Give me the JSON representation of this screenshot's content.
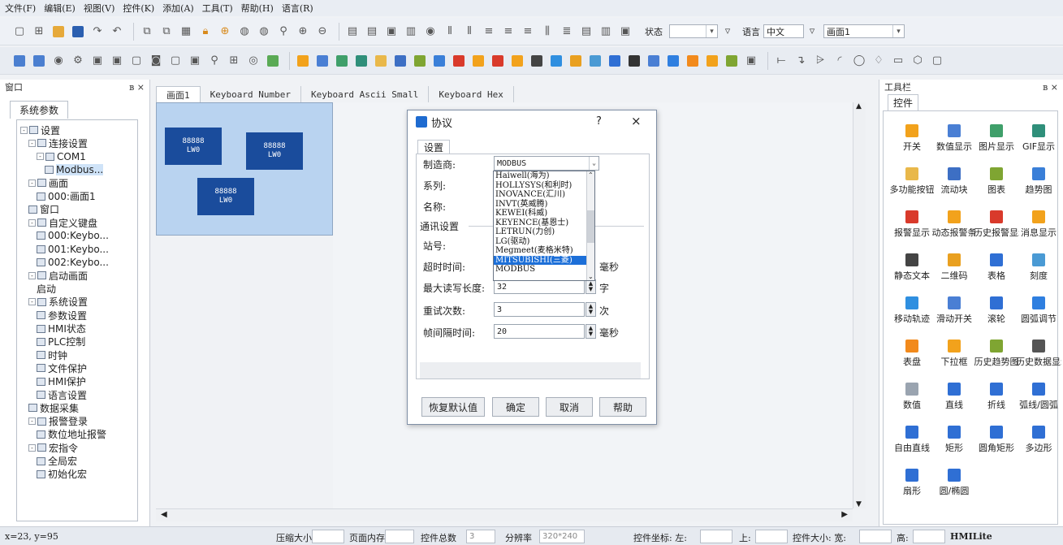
{
  "menu": [
    "文件(F)",
    "编辑(E)",
    "视图(V)",
    "控件(K)",
    "添加(A)",
    "工具(T)",
    "帮助(H)",
    "语言(R)"
  ],
  "toolbar": {
    "state_label": "状态",
    "state_value": "",
    "lang_label": "语言",
    "lang_value": "中文",
    "screen_value": "画面1"
  },
  "left_panel": {
    "title": "窗口",
    "pin": "ʙ ×",
    "tab": "系统参数",
    "tree": [
      {
        "label": "设置",
        "level": 0,
        "toggle": "-"
      },
      {
        "label": "连接设置",
        "level": 1,
        "toggle": "-"
      },
      {
        "label": "COM1",
        "level": 2,
        "toggle": "-"
      },
      {
        "label": "Modbus...",
        "level": 3,
        "toggle": "",
        "selected": true
      },
      {
        "label": "画面",
        "level": 1,
        "toggle": "-"
      },
      {
        "label": "000:画面1",
        "level": 2,
        "toggle": ""
      },
      {
        "label": "窗口",
        "level": 1,
        "toggle": ""
      },
      {
        "label": "自定义键盘",
        "level": 1,
        "toggle": "-"
      },
      {
        "label": "000:Keybo...",
        "level": 2,
        "toggle": ""
      },
      {
        "label": "001:Keybo...",
        "level": 2,
        "toggle": ""
      },
      {
        "label": "002:Keybo...",
        "level": 2,
        "toggle": ""
      },
      {
        "label": "启动画面",
        "level": 1,
        "toggle": "-"
      },
      {
        "label": "启动",
        "level": 2,
        "toggle": "",
        "noicon": true
      },
      {
        "label": "系统设置",
        "level": 1,
        "toggle": "-"
      },
      {
        "label": "参数设置",
        "level": 2,
        "toggle": ""
      },
      {
        "label": "HMI状态",
        "level": 2,
        "toggle": ""
      },
      {
        "label": "PLC控制",
        "level": 2,
        "toggle": ""
      },
      {
        "label": "时钟",
        "level": 2,
        "toggle": ""
      },
      {
        "label": "文件保护",
        "level": 2,
        "toggle": ""
      },
      {
        "label": "HMI保护",
        "level": 2,
        "toggle": ""
      },
      {
        "label": "语言设置",
        "level": 2,
        "toggle": ""
      },
      {
        "label": "数据采集",
        "level": 1,
        "toggle": ""
      },
      {
        "label": "报警登录",
        "level": 1,
        "toggle": "-"
      },
      {
        "label": "数位地址报警",
        "level": 2,
        "toggle": ""
      },
      {
        "label": "宏指令",
        "level": 1,
        "toggle": "-"
      },
      {
        "label": "全局宏",
        "level": 2,
        "toggle": ""
      },
      {
        "label": "初始化宏",
        "level": 2,
        "toggle": ""
      }
    ]
  },
  "tabs": [
    "画面1",
    "Keyboard Number",
    "Keyboard Ascii Small",
    "Keyboard Hex"
  ],
  "canvas": {
    "numeric": [
      {
        "value": "88888",
        "sub": "LW0"
      },
      {
        "value": "88888",
        "sub": "LW0"
      },
      {
        "value": "88888",
        "sub": "LW0"
      }
    ]
  },
  "dialog": {
    "title": "协议",
    "help": "?",
    "close": "×",
    "tab": "设置",
    "maker_label": "制造商:",
    "maker_value": "MODBUS",
    "series_label": "系列:",
    "name_label": "名称:",
    "comm_label": "通讯设置",
    "station_label": "站号:",
    "timeout_label": "超时时间:",
    "timeout_unit": "毫秒",
    "maxlen_label": "最大读写长度:",
    "maxlen_value": "32",
    "maxlen_unit": "字",
    "retry_label": "重试次数:",
    "retry_value": "3",
    "retry_unit": "次",
    "interval_label": "帧间隔时间:",
    "interval_value": "20",
    "interval_unit": "毫秒",
    "options": [
      "Haiwell(海为)",
      "HOLLYSYS(和利时)",
      "INOVANCE(汇川)",
      "INVT(英威腾)",
      "KEWEI(科威)",
      "KEYENCE(基恩士)",
      "LETRUN(力创)",
      "LG(驱动)",
      "Megmeet(麦格米特)",
      "MITSUBISHI(三菱)",
      "MODBUS"
    ],
    "highlighted": "MITSUBISHI(三菱)",
    "buttons": {
      "restore": "恢复默认值",
      "ok": "确定",
      "cancel": "取消",
      "help": "帮助"
    }
  },
  "right_panel": {
    "title": "工具栏",
    "pin": "ʙ ×",
    "tab": "控件",
    "widgets": [
      {
        "label": "开关",
        "color": "#f2a21c"
      },
      {
        "label": "数值显示",
        "color": "#4a7fd4"
      },
      {
        "label": "图片显示",
        "color": "#3f9f6a"
      },
      {
        "label": "GIF显示",
        "color": "#2f8f7a"
      },
      {
        "label": "多功能按钮",
        "color": "#e9b84a"
      },
      {
        "label": "流动块",
        "color": "#3d6fc4"
      },
      {
        "label": "图表",
        "color": "#7fa532"
      },
      {
        "label": "趋势图",
        "color": "#3a7fd8"
      },
      {
        "label": "报警显示",
        "color": "#d93a2b"
      },
      {
        "label": "动态报警条",
        "color": "#f2a21c"
      },
      {
        "label": "历史报警显示",
        "color": "#d93a2b"
      },
      {
        "label": "消息显示",
        "color": "#f2a21c"
      },
      {
        "label": "静态文本",
        "color": "#444444"
      },
      {
        "label": "二维码",
        "color": "#e9a020"
      },
      {
        "label": "表格",
        "color": "#2f6fd4"
      },
      {
        "label": "刻度",
        "color": "#4a9ad4"
      },
      {
        "label": "移动轨迹",
        "color": "#2f8fe0"
      },
      {
        "label": "滑动开关",
        "color": "#4a7fd4"
      },
      {
        "label": "滚轮",
        "color": "#2f6fd4"
      },
      {
        "label": "圆弧调节",
        "color": "#2f7fe0"
      },
      {
        "label": "表盘",
        "color": "#f28a1c"
      },
      {
        "label": "下拉框",
        "color": "#f2a21c"
      },
      {
        "label": "历史趋势图",
        "color": "#7fa532"
      },
      {
        "label": "历史数据显示器",
        "color": "#555555"
      },
      {
        "label": "数值",
        "color": "#9aa4b0"
      },
      {
        "label": "直线",
        "color": "#2f6fd4"
      },
      {
        "label": "折线",
        "color": "#2f6fd4"
      },
      {
        "label": "弧线/圆弧",
        "color": "#2f6fd4"
      },
      {
        "label": "自由直线",
        "color": "#2f6fd4"
      },
      {
        "label": "矩形",
        "color": "#2f6fd4"
      },
      {
        "label": "圆角矩形",
        "color": "#2f6fd4"
      },
      {
        "label": "多边形",
        "color": "#2f6fd4"
      },
      {
        "label": "扇形",
        "color": "#2f6fd4"
      },
      {
        "label": "圆/椭圆",
        "color": "#2f6fd4"
      }
    ]
  },
  "status": {
    "coords": "x=23, y=95",
    "compress_label": "压缩大小",
    "pageinner_label": "页面内存",
    "total_label": "控件总数",
    "total_value": "3",
    "resolution_label": "分辨率",
    "resolution_value": "320*240",
    "pos_label": "控件坐标: 左:",
    "top_label": "上:",
    "size_label": "控件大小: 宽:",
    "height_label": "高:",
    "product": "HMILite"
  }
}
